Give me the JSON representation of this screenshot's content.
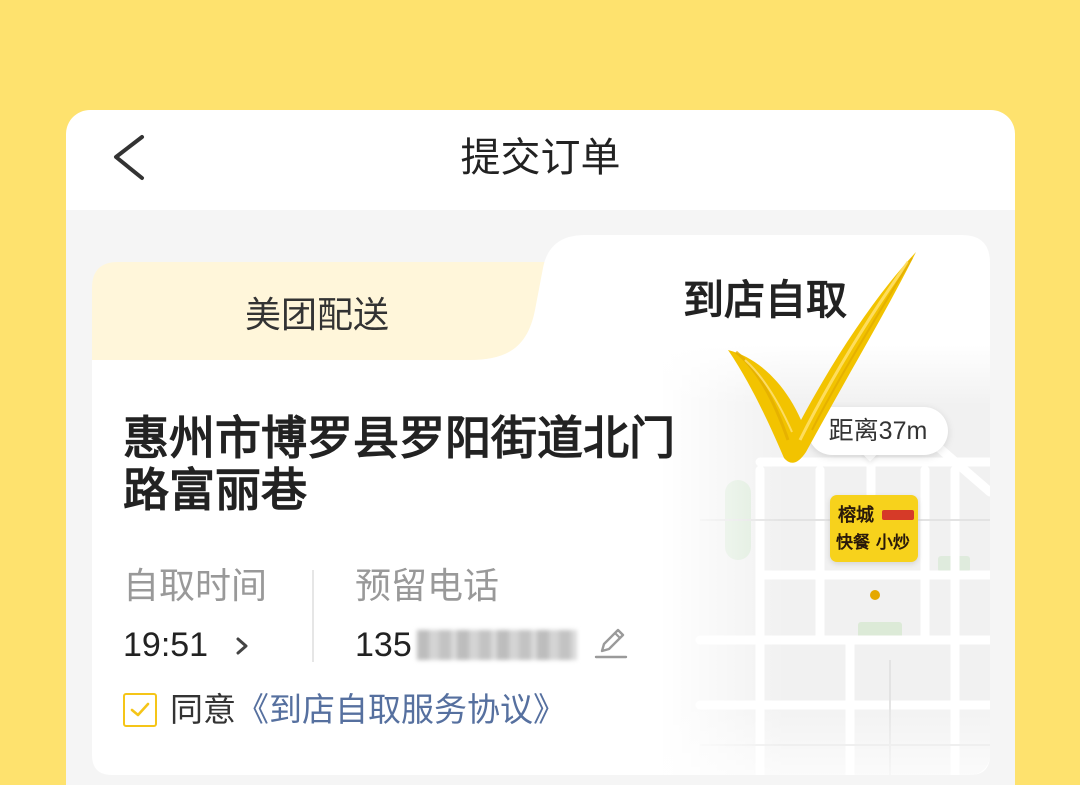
{
  "header": {
    "title": "提交订单"
  },
  "tabs": [
    {
      "label": "美团配送",
      "active": false
    },
    {
      "label": "到店自取",
      "active": true
    }
  ],
  "address": "惠州市博罗县罗阳街道北门路富丽巷",
  "pickup_time": {
    "label": "自取时间",
    "value": "19:51"
  },
  "phone": {
    "label": "预留电话",
    "value": "135"
  },
  "agreement": {
    "checked": true,
    "prefix": "同意",
    "link_text": "《到店自取服务协议》"
  },
  "map": {
    "distance": "距离37m",
    "store_logo": {
      "line1": "榕城",
      "line2": "快餐 小炒"
    }
  },
  "icons": {
    "back": "chevron-left-icon",
    "time_picker": "chevron-right-icon",
    "edit_phone": "pencil-icon",
    "agreement_checkbox": "checkbox-checked-icon",
    "selected_tab_mark": "checkmark-brush-icon"
  },
  "colors": {
    "page_background": "#FEE26E",
    "accent_yellow": "#F5C518",
    "tab_inactive_background": "#FFF6DA",
    "link": "#56709F",
    "text_primary": "#222222",
    "text_secondary": "#999999"
  }
}
